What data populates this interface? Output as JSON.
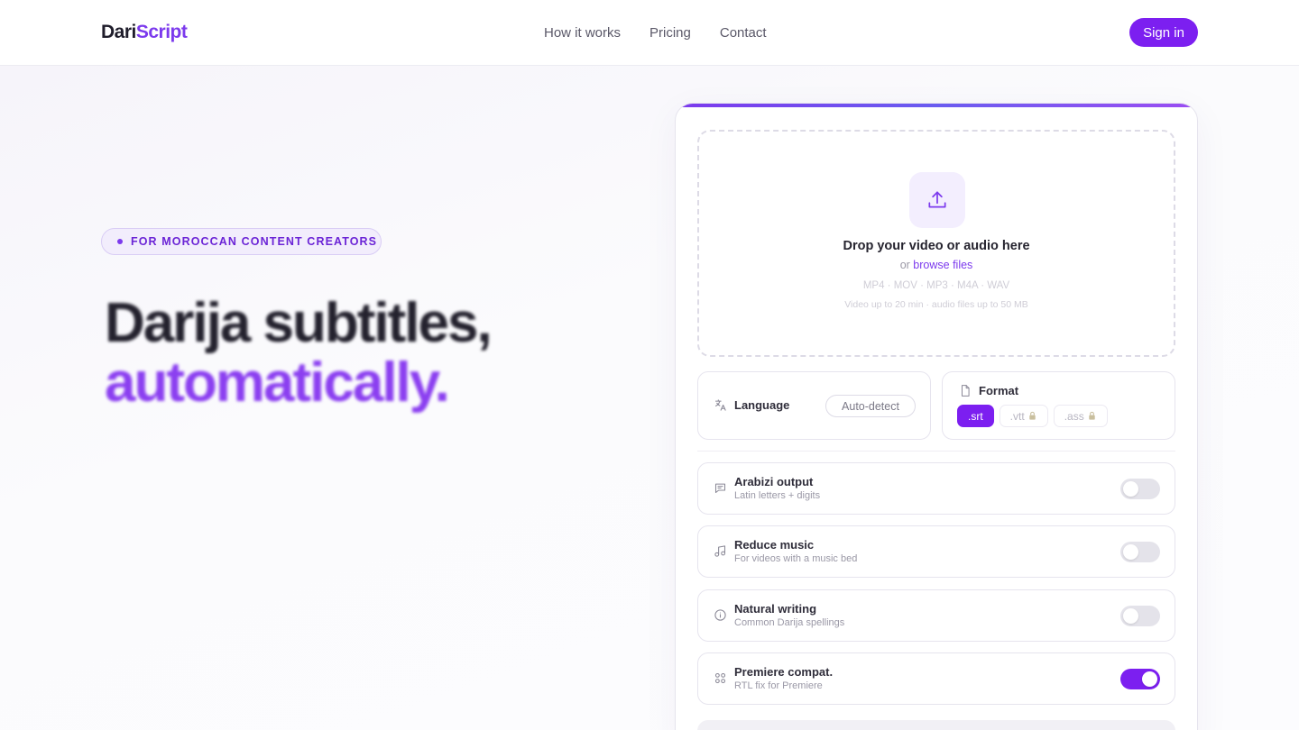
{
  "header": {
    "logo_part1": "Dari",
    "logo_part2": "Script",
    "nav": [
      "How it works",
      "Pricing",
      "Contact"
    ],
    "signin_label": "Sign in"
  },
  "hero": {
    "badge": "FOR MOROCCAN CONTENT CREATORS",
    "headline_line1": "Darija subtitles,",
    "headline_line2": "automatically."
  },
  "upload": {
    "title": "Drop your video or audio here",
    "or_text": "or",
    "browse_label": "browse files",
    "formats": "MP4 · MOV · MP3 · M4A · WAV",
    "limits": "Video up to 20 min · audio files up to 50 MB"
  },
  "language": {
    "label": "Language",
    "value": "Auto-detect"
  },
  "format": {
    "label": "Format",
    "options": [
      ".srt",
      ".vtt",
      ".ass"
    ],
    "selected": ".srt"
  },
  "options": [
    {
      "title": "Arabizi output",
      "subtitle": "Latin letters + digits",
      "enabled": false,
      "icon": "chat-icon"
    },
    {
      "title": "Reduce music",
      "subtitle": "For videos with a music bed",
      "enabled": false,
      "icon": "music-icon"
    },
    {
      "title": "Natural writing",
      "subtitle": "Common Darija spellings",
      "enabled": false,
      "icon": "info-icon"
    },
    {
      "title": "Premiere compat.",
      "subtitle": "RTL fix for Premiere",
      "enabled": true,
      "icon": "grid-icon"
    }
  ],
  "colors": {
    "accent": "#7c1ff0",
    "accent_light": "#f3eefe",
    "headline_dark": "#24222e",
    "headline_purple": "#8b3ff0"
  }
}
